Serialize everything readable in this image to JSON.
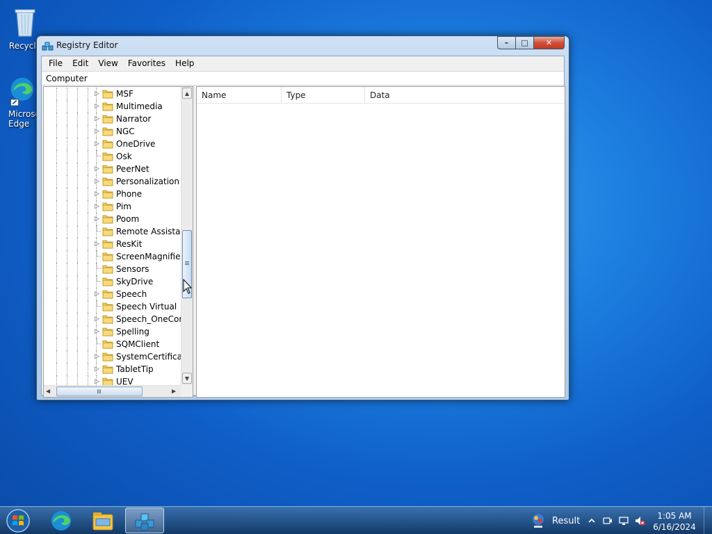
{
  "desktop": {
    "icons": [
      {
        "label": "Recycle"
      },
      {
        "label": "Microsoft Edge"
      }
    ]
  },
  "window": {
    "title": "Registry Editor",
    "caption": {
      "minimize": "–",
      "maximize": "□",
      "close": "✕"
    },
    "menu": [
      "File",
      "Edit",
      "View",
      "Favorites",
      "Help"
    ],
    "address": "Computer",
    "tree": {
      "items": [
        {
          "label": "MSF",
          "expandable": true
        },
        {
          "label": "Multimedia",
          "expandable": true
        },
        {
          "label": "Narrator",
          "expandable": true
        },
        {
          "label": "NGC",
          "expandable": true
        },
        {
          "label": "OneDrive",
          "expandable": true
        },
        {
          "label": "Osk",
          "expandable": false
        },
        {
          "label": "PeerNet",
          "expandable": true
        },
        {
          "label": "Personalization",
          "expandable": true
        },
        {
          "label": "Phone",
          "expandable": true
        },
        {
          "label": "Pim",
          "expandable": true
        },
        {
          "label": "Poom",
          "expandable": true
        },
        {
          "label": "Remote Assistance",
          "expandable": false
        },
        {
          "label": "ResKit",
          "expandable": true
        },
        {
          "label": "ScreenMagnifier",
          "expandable": false
        },
        {
          "label": "Sensors",
          "expandable": false
        },
        {
          "label": "SkyDrive",
          "expandable": false
        },
        {
          "label": "Speech",
          "expandable": true
        },
        {
          "label": "Speech Virtual",
          "expandable": false
        },
        {
          "label": "Speech_OneCore",
          "expandable": true
        },
        {
          "label": "Spelling",
          "expandable": true
        },
        {
          "label": "SQMClient",
          "expandable": false
        },
        {
          "label": "SystemCertificates",
          "expandable": true
        },
        {
          "label": "TabletTip",
          "expandable": true
        },
        {
          "label": "UEV",
          "expandable": true
        }
      ]
    },
    "list": {
      "columns": [
        "Name",
        "Type",
        "Data"
      ],
      "rows": []
    }
  },
  "taskbar": {
    "apps": [
      {
        "icon": "edge-icon",
        "active": false
      },
      {
        "icon": "file-explorer-icon",
        "active": false
      },
      {
        "icon": "registry-editor-icon",
        "active": true
      }
    ],
    "tray": {
      "result_label": "Result",
      "time": "1:05 AM",
      "date": "6/16/2024"
    }
  }
}
